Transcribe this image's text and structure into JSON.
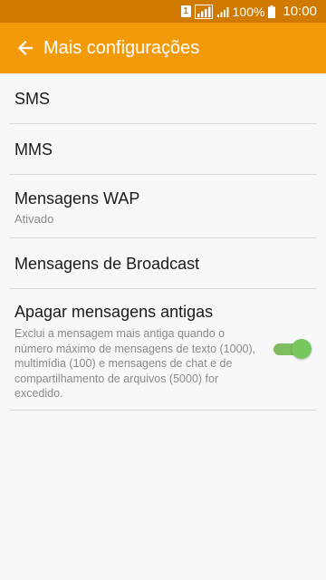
{
  "status_bar": {
    "sim_badge": "1",
    "battery": "100%",
    "time": "10:00",
    "icons": [
      "sim-icon",
      "signal-icon",
      "signal-icon",
      "battery-icon"
    ]
  },
  "app_bar": {
    "title": "Mais configurações",
    "back_icon": "arrow-left-icon",
    "background": "#f39a0b",
    "status_background": "#d17a00"
  },
  "items": [
    {
      "title": "SMS"
    },
    {
      "title": "MMS"
    },
    {
      "title": "Mensagens WAP",
      "subtitle": "Ativado"
    },
    {
      "title": "Mensagens de Broadcast"
    },
    {
      "title": "Apagar mensagens antigas",
      "description": "Exclui a mensagem mais antiga quando o número máximo de mensagens de texto (1000), multimídia (100) e mensagens de chat e de compartilhamento de arquivos (5000) for excedido.",
      "toggle_on": true,
      "toggle_color": "#76c85e"
    }
  ]
}
